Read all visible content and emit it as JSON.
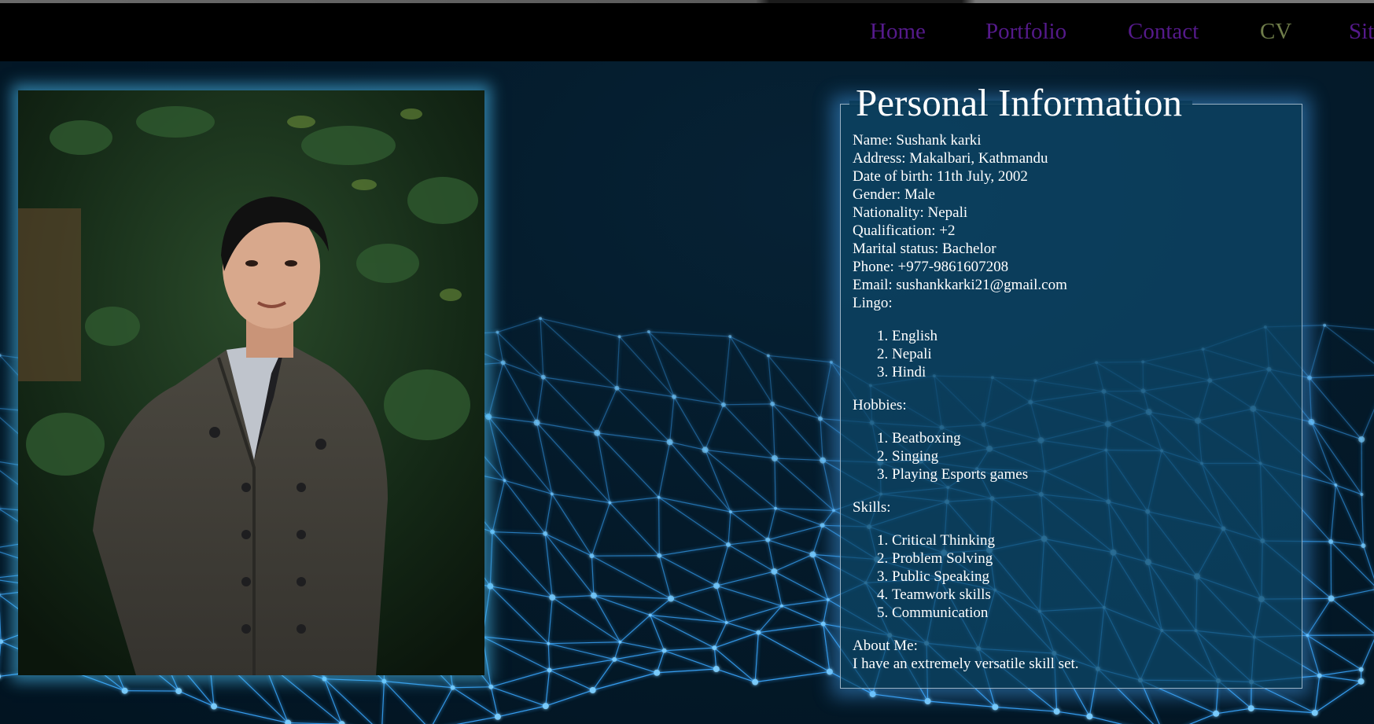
{
  "nav": {
    "home": "Home",
    "portfolio": "Portfolio",
    "contact": "Contact",
    "cv": "CV",
    "site": "Sit"
  },
  "info": {
    "title": "Personal Information",
    "name": "Name: Sushank karki",
    "address": "Address: Makalbari, Kathmandu",
    "dob": "Date of birth: 11th July, 2002",
    "gender": "Gender: Male",
    "nationality": "Nationality: Nepali",
    "qualification": "Qualification: +2",
    "marital": "Marital status: Bachelor",
    "phone": "Phone: +977-9861607208",
    "email": "Email: sushankkarki21@gmail.com",
    "lingo_label": "Lingo:",
    "lingo": [
      "English",
      "Nepali",
      "Hindi"
    ],
    "hobbies_label": "Hobbies:",
    "hobbies": [
      "Beatboxing",
      "Singing",
      "Playing Esports games"
    ],
    "skills_label": "Skills:",
    "skills": [
      "Critical Thinking",
      "Problem Solving",
      "Public Speaking",
      "Teamwork skills",
      "Communication"
    ],
    "about_label": "About Me:",
    "about_text": "I have an extremely versatile skill set."
  },
  "colors": {
    "nav_link": "#551a8b",
    "nav_cv": "#6f7d4a",
    "panel_glow": "#46aaff",
    "network": "#3aa8ff"
  }
}
